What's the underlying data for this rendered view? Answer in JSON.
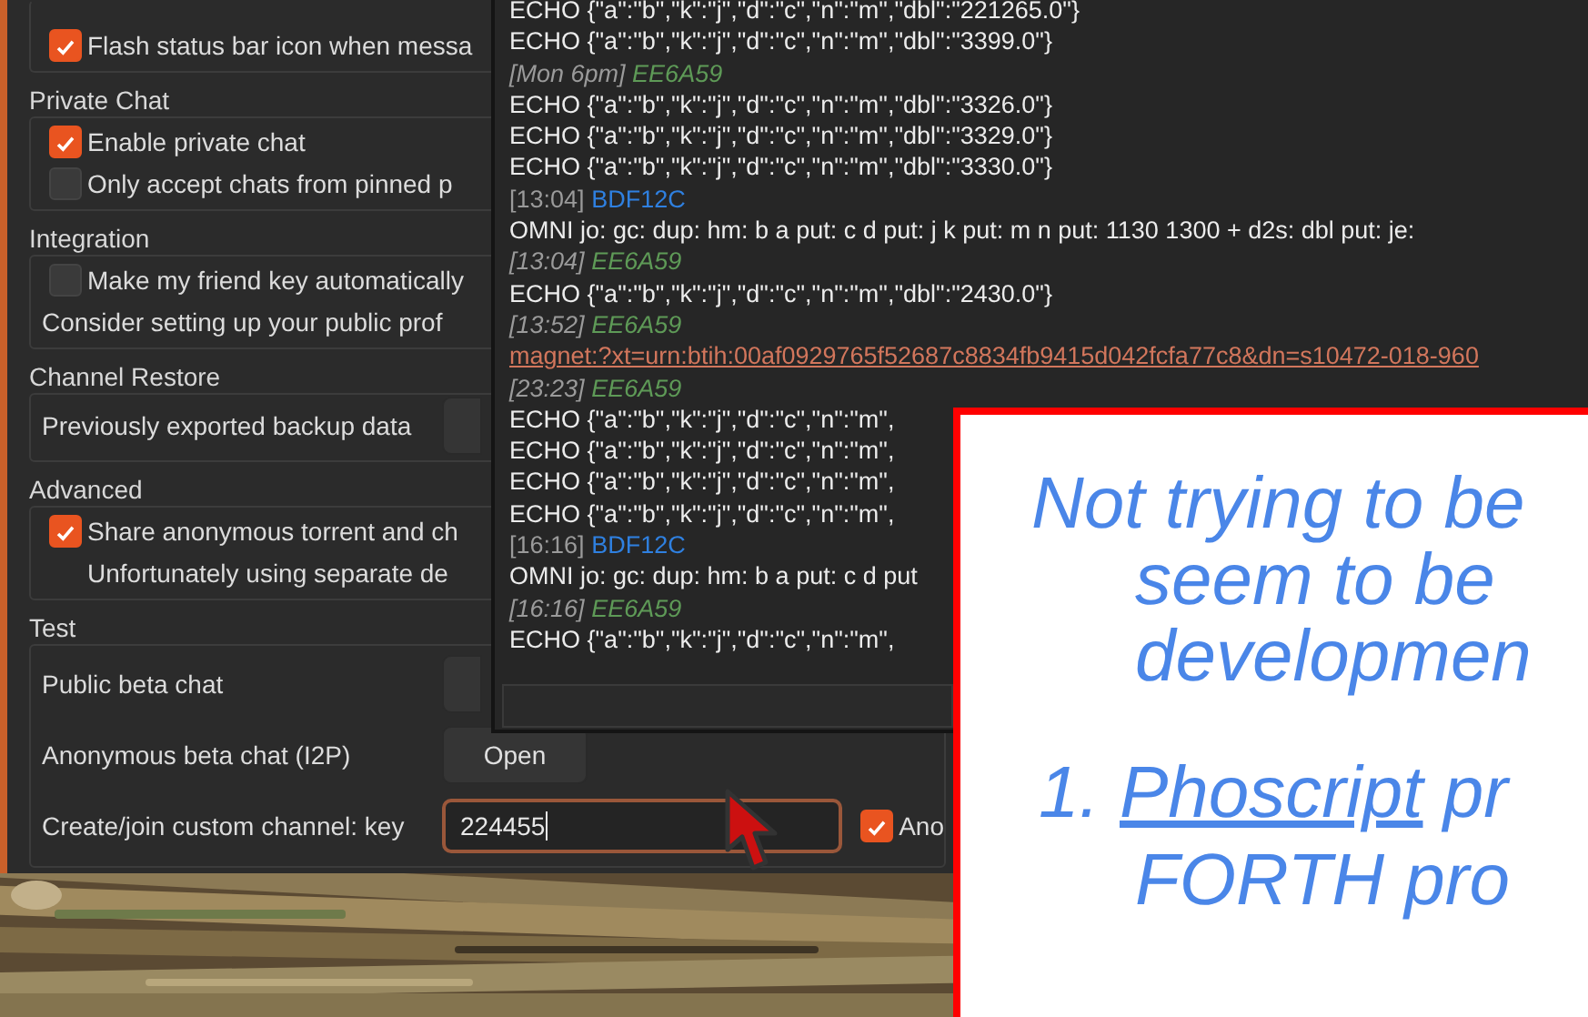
{
  "settings": {
    "groups": [
      {
        "rows": [
          {
            "kind": "checkbox",
            "label": "Flash status bar icon when messa",
            "checked": true
          }
        ]
      },
      {
        "title": "Private Chat",
        "rows": [
          {
            "kind": "checkbox",
            "label": "Enable private chat",
            "checked": true
          },
          {
            "kind": "checkbox",
            "label": "Only accept chats from pinned p",
            "checked": false
          }
        ]
      },
      {
        "title": "Integration",
        "rows": [
          {
            "kind": "checkbox",
            "label": "Make my friend key automatically",
            "checked": false
          },
          {
            "kind": "note",
            "label": "Consider setting up your public prof"
          }
        ]
      },
      {
        "title": "Channel Restore",
        "rows": [
          {
            "kind": "button",
            "label": "Previously exported backup data"
          }
        ]
      },
      {
        "title": "Advanced",
        "rows": [
          {
            "kind": "checkbox",
            "label": "Share anonymous torrent and ch",
            "checked": true
          },
          {
            "kind": "hint",
            "label": "Unfortunately using separate de"
          }
        ]
      },
      {
        "title": "Test",
        "rows": [
          {
            "kind": "button",
            "label": "Public beta chat"
          },
          {
            "kind": "button",
            "label": "Anonymous beta chat (I2P)",
            "button": "Open"
          },
          {
            "kind": "field",
            "label": "Create/join custom channel: key",
            "value": "224455",
            "option": {
              "label": "Ano",
              "checked": true
            }
          }
        ]
      }
    ]
  },
  "chat": {
    "messages": [
      {
        "kind": "text",
        "text": "ECHO {\"a\":\"b\",\"k\":\"j\",\"d\":\"c\",\"n\":\"m\",\"dbl\":\"221265.0\"}"
      },
      {
        "kind": "text",
        "text": "ECHO {\"a\":\"b\",\"k\":\"j\",\"d\":\"c\",\"n\":\"m\",\"dbl\":\"3399.0\"}"
      },
      {
        "kind": "own_header",
        "time": "[Mon 6pm]",
        "author": "EE6A59",
        "color": "#5e9a57"
      },
      {
        "kind": "text",
        "text": "ECHO {\"a\":\"b\",\"k\":\"j\",\"d\":\"c\",\"n\":\"m\",\"dbl\":\"3326.0\"}"
      },
      {
        "kind": "text",
        "text": "ECHO {\"a\":\"b\",\"k\":\"j\",\"d\":\"c\",\"n\":\"m\",\"dbl\":\"3329.0\"}"
      },
      {
        "kind": "text",
        "text": "ECHO {\"a\":\"b\",\"k\":\"j\",\"d\":\"c\",\"n\":\"m\",\"dbl\":\"3330.0\"}"
      },
      {
        "kind": "peer_header",
        "time": "[13:04]",
        "author": "BDF12C",
        "color": "#2f80e0"
      },
      {
        "kind": "text",
        "text": "OMNI jo: gc: dup: hm: b a put: c d put: j k put: m n put: 1130 1300 + d2s: dbl put: je:"
      },
      {
        "kind": "own_header",
        "time": "[13:04]",
        "author": "EE6A59",
        "color": "#5e9a57"
      },
      {
        "kind": "text",
        "text": "ECHO {\"a\":\"b\",\"k\":\"j\",\"d\":\"c\",\"n\":\"m\",\"dbl\":\"2430.0\"}"
      },
      {
        "kind": "own_header",
        "time": "[13:52]",
        "author": "EE6A59",
        "color": "#5e9a57"
      },
      {
        "kind": "link",
        "text": "magnet:?xt=urn:btih:00af0929765f52687c8834fb9415d042fcfa77c8&dn=s10472-018-960"
      },
      {
        "kind": "own_header",
        "time": "[23:23]",
        "author": "EE6A59",
        "color": "#5e9a57"
      },
      {
        "kind": "text",
        "text": "ECHO {\"a\":\"b\",\"k\":\"j\",\"d\":\"c\",\"n\":\"m\","
      },
      {
        "kind": "text",
        "text": "ECHO {\"a\":\"b\",\"k\":\"j\",\"d\":\"c\",\"n\":\"m\","
      },
      {
        "kind": "text",
        "text": "ECHO {\"a\":\"b\",\"k\":\"j\",\"d\":\"c\",\"n\":\"m\","
      },
      {
        "kind": "text",
        "text": "ECHO {\"a\":\"b\",\"k\":\"j\",\"d\":\"c\",\"n\":\"m\","
      },
      {
        "kind": "peer_header",
        "time": "[16:16]",
        "author": "BDF12C",
        "color": "#2f80e0"
      },
      {
        "kind": "text",
        "text": "OMNI jo: gc: dup: hm: b a put: c d put"
      },
      {
        "kind": "own_header",
        "time": "[16:16]",
        "author": "EE6A59",
        "color": "#5e9a57"
      },
      {
        "kind": "text",
        "text": "ECHO {\"a\":\"b\",\"k\":\"j\",\"d\":\"c\",\"n\":\"m\","
      }
    ]
  },
  "slide": {
    "lines": [
      "Not trying to be",
      "seem to be",
      "developmen"
    ],
    "list_item": {
      "number": "1.",
      "link": "Phoscript",
      "text": "pr",
      "continuation": "FORTH pro"
    }
  }
}
